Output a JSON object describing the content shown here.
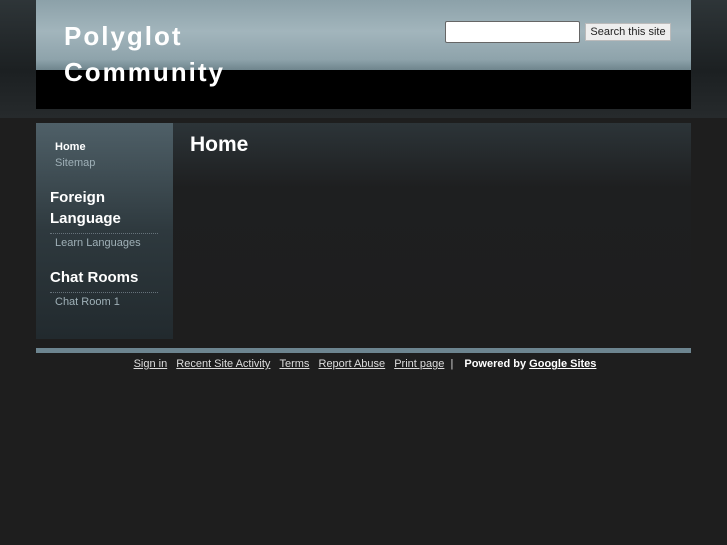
{
  "header": {
    "title": "Polyglot Community",
    "search_button": "Search this site",
    "search_value": ""
  },
  "sidebar": {
    "items": [
      {
        "label": "Home"
      },
      {
        "label": "Sitemap"
      }
    ],
    "sections": [
      {
        "title": "Foreign Language",
        "items": [
          "Learn Languages"
        ]
      },
      {
        "title": "Chat Rooms",
        "items": [
          "Chat Room 1"
        ]
      }
    ]
  },
  "main": {
    "page_title": "Home"
  },
  "footer": {
    "links": [
      "Sign in",
      "Recent Site Activity",
      "Terms",
      "Report Abuse",
      "Print page"
    ],
    "separator": "|",
    "powered_by": "Powered by",
    "google_sites": "Google Sites"
  }
}
